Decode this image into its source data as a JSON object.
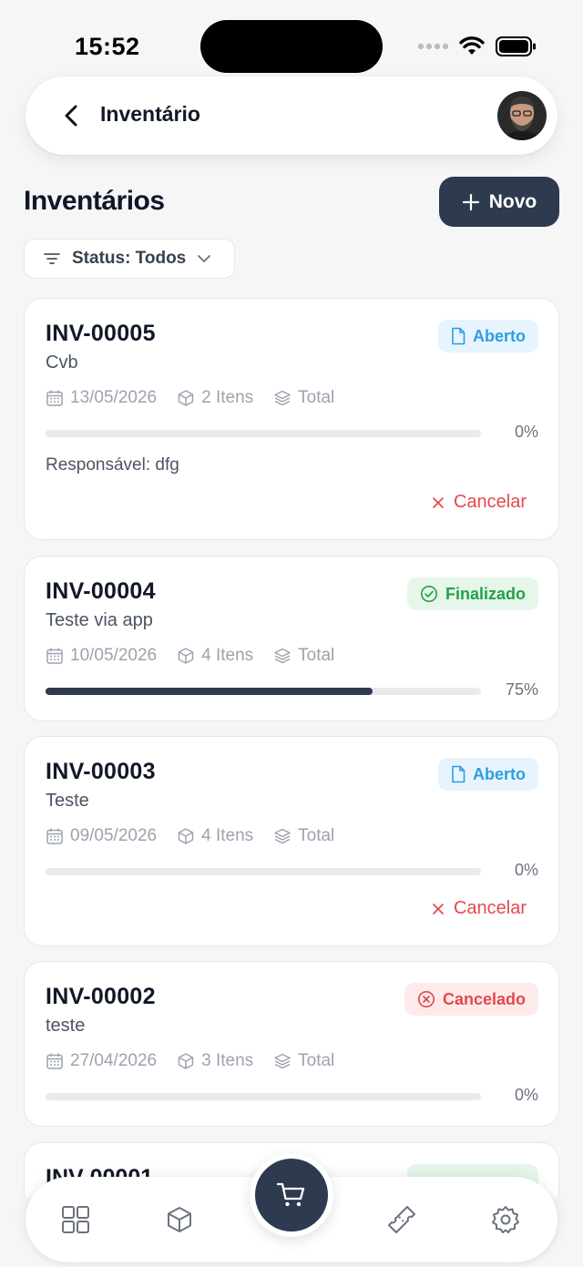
{
  "status_bar": {
    "time": "15:52"
  },
  "header": {
    "title": "Inventário",
    "avatar": "user-avatar"
  },
  "page": {
    "title": "Inventários",
    "new_button_label": "Novo",
    "filter_label": "Status: Todos"
  },
  "cards": [
    {
      "code": "INV-00005",
      "description": "Cvb",
      "status": "Aberto",
      "date": "13/05/2026",
      "items": "2 Itens",
      "scope": "Total",
      "progress": 0,
      "progress_label": "0%",
      "responsavel": "Responsável: dfg",
      "cancel_label": "Cancelar"
    },
    {
      "code": "INV-00004",
      "description": "Teste via app",
      "status": "Finalizado",
      "date": "10/05/2026",
      "items": "4 Itens",
      "scope": "Total",
      "progress": 75,
      "progress_label": "75%"
    },
    {
      "code": "INV-00003",
      "description": "Teste",
      "status": "Aberto",
      "date": "09/05/2026",
      "items": "4 Itens",
      "scope": "Total",
      "progress": 0,
      "progress_label": "0%",
      "cancel_label": "Cancelar"
    },
    {
      "code": "INV-00002",
      "description": "teste",
      "status": "Cancelado",
      "date": "27/04/2026",
      "items": "3 Itens",
      "scope": "Total",
      "progress": 0,
      "progress_label": "0%"
    }
  ],
  "partial_card": {
    "code": "INV-00001"
  },
  "colors": {
    "primary": "#2d3a4f",
    "open": "#2b9fe0",
    "finished": "#22a24a",
    "cancelled": "#e5484d"
  },
  "bottom_nav": {
    "items": [
      "grid-icon",
      "box-icon",
      "cart-icon",
      "ticket-icon",
      "gear-icon"
    ]
  }
}
